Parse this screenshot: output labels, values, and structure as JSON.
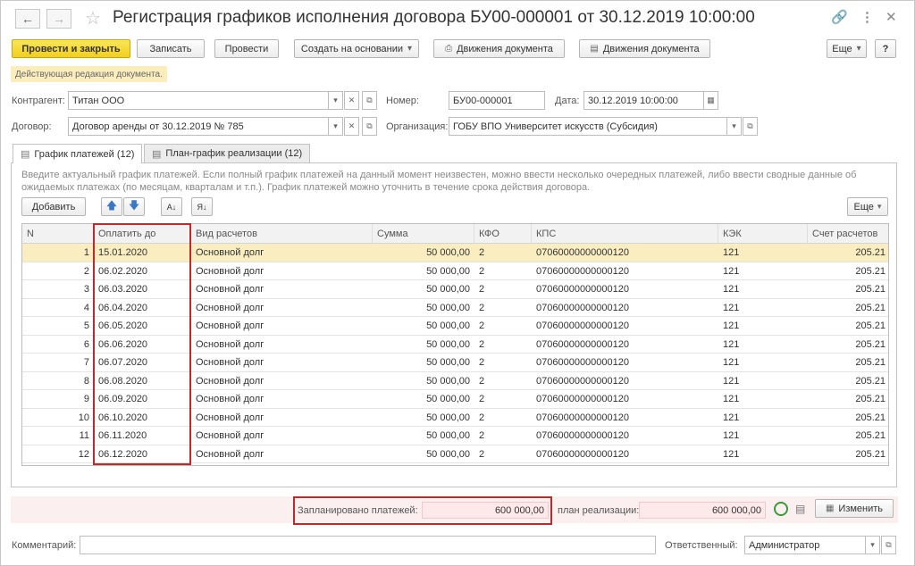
{
  "header": {
    "title": "Регистрация графиков исполнения договора БУ00-000001 от 30.12.2019 10:00:00"
  },
  "toolbar": {
    "post_close": "Провести и закрыть",
    "save": "Записать",
    "post": "Провести",
    "create_based": "Создать на основании",
    "movements1": "Движения документа",
    "movements2": "Движения документа",
    "more": "Еще",
    "help": "?"
  },
  "notice": "Действующая редакция документа.",
  "form": {
    "counterparty_label": "Контрагент:",
    "counterparty_value": "Титан ООО",
    "number_label": "Номер:",
    "number_value": "БУ00-000001",
    "date_label": "Дата:",
    "date_value": "30.12.2019 10:00:00",
    "contract_label": "Договор:",
    "contract_value": "Договор аренды от 30.12.2019 № 785",
    "org_label": "Организация:",
    "org_value": "ГОБУ ВПО Университет искусств (Субсидия)"
  },
  "tabs": [
    {
      "label": "График платежей (12)"
    },
    {
      "label": "План-график реализации (12)"
    }
  ],
  "hint": "Введите актуальный график платежей. Если полный график платежей на данный момент неизвестен, можно ввести несколько очередных платежей, либо ввести сводные данные об ожидаемых платежах (по месяцам, кварталам и т.п.). График платежей можно уточнить в течение срока действия договора.",
  "table_toolbar": {
    "add": "Добавить",
    "more": "Еще"
  },
  "table": {
    "columns": [
      "N",
      "Оплатить до",
      "Вид расчетов",
      "Сумма",
      "КФО",
      "КПС",
      "КЭК",
      "Счет расчетов"
    ],
    "rows": [
      [
        "1",
        "15.01.2020",
        "Основной долг",
        "50 000,00",
        "2",
        "07060000000000120",
        "121",
        "205.21"
      ],
      [
        "2",
        "06.02.2020",
        "Основной долг",
        "50 000,00",
        "2",
        "07060000000000120",
        "121",
        "205.21"
      ],
      [
        "3",
        "06.03.2020",
        "Основной долг",
        "50 000,00",
        "2",
        "07060000000000120",
        "121",
        "205.21"
      ],
      [
        "4",
        "06.04.2020",
        "Основной долг",
        "50 000,00",
        "2",
        "07060000000000120",
        "121",
        "205.21"
      ],
      [
        "5",
        "06.05.2020",
        "Основной долг",
        "50 000,00",
        "2",
        "07060000000000120",
        "121",
        "205.21"
      ],
      [
        "6",
        "06.06.2020",
        "Основной долг",
        "50 000,00",
        "2",
        "07060000000000120",
        "121",
        "205.21"
      ],
      [
        "7",
        "06.07.2020",
        "Основной долг",
        "50 000,00",
        "2",
        "07060000000000120",
        "121",
        "205.21"
      ],
      [
        "8",
        "06.08.2020",
        "Основной долг",
        "50 000,00",
        "2",
        "07060000000000120",
        "121",
        "205.21"
      ],
      [
        "9",
        "06.09.2020",
        "Основной долг",
        "50 000,00",
        "2",
        "07060000000000120",
        "121",
        "205.21"
      ],
      [
        "10",
        "06.10.2020",
        "Основной долг",
        "50 000,00",
        "2",
        "07060000000000120",
        "121",
        "205.21"
      ],
      [
        "11",
        "06.11.2020",
        "Основной долг",
        "50 000,00",
        "2",
        "07060000000000120",
        "121",
        "205.21"
      ],
      [
        "12",
        "06.12.2020",
        "Основной долг",
        "50 000,00",
        "2",
        "07060000000000120",
        "121",
        "205.21"
      ]
    ]
  },
  "footer": {
    "planned_label": "Запланировано платежей:",
    "planned_value": "600 000,00",
    "plan_label": "план реализации:",
    "plan_value": "600 000,00",
    "change": "Изменить"
  },
  "bottom": {
    "comment_label": "Комментарий:",
    "comment_value": "",
    "responsible_label": "Ответственный:",
    "responsible_value": "Администратор"
  },
  "colors": {
    "primary_button": "#f2cf1e",
    "selected_row": "#faeec0",
    "highlight_box": "#c0282a"
  }
}
